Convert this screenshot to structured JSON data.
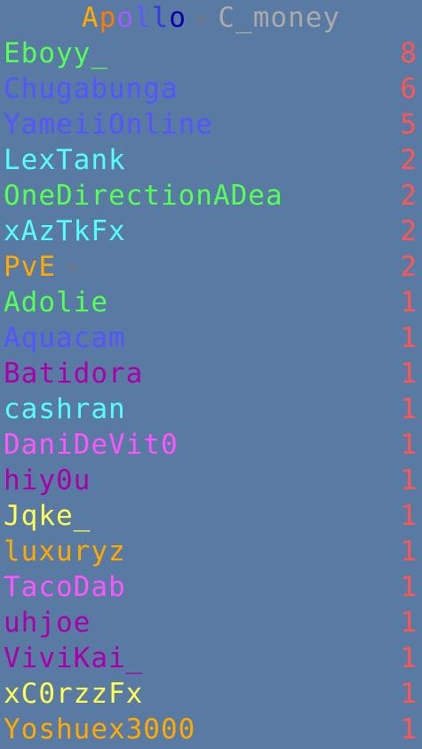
{
  "header": {
    "brand_letters": [
      {
        "ch": "A",
        "color": "#FFAA00"
      },
      {
        "ch": "p",
        "color": "#FF7A00"
      },
      {
        "ch": "o",
        "color": "#A35AFF"
      },
      {
        "ch": "l",
        "color": "#5A5AFF"
      },
      {
        "ch": "l",
        "color": "#3A3AE0"
      },
      {
        "ch": "o",
        "color": "#0000AA"
      }
    ],
    "separator": "»",
    "server_name": "C_money"
  },
  "scoreboard": [
    {
      "name": "Eboyy_",
      "score": "8",
      "color": "#55FF55"
    },
    {
      "name": "Chugabunga",
      "score": "6",
      "color": "#5555FF"
    },
    {
      "name": "YameiiOnline",
      "score": "5",
      "color": "#5555FF"
    },
    {
      "name": "LexTank",
      "score": "2",
      "color": "#55FFFF"
    },
    {
      "name": "OneDirectionADea",
      "score": "2",
      "color": "#55FF55"
    },
    {
      "name": "xAzTkFx",
      "score": "2",
      "color": "#55FFFF"
    },
    {
      "name": "PvE",
      "score": "2",
      "color": "#FFAA00",
      "suffix": "»"
    },
    {
      "name": "Adolie",
      "score": "1",
      "color": "#55FF55"
    },
    {
      "name": "Aquacam",
      "score": "1",
      "color": "#5555FF"
    },
    {
      "name": "Batidora",
      "score": "1",
      "color": "#AA00AA"
    },
    {
      "name": "cashran",
      "score": "1",
      "color": "#55FFFF"
    },
    {
      "name": "DaniDeVit0",
      "score": "1",
      "color": "#FF55FF"
    },
    {
      "name": "hiy0u",
      "score": "1",
      "color": "#AA00AA"
    },
    {
      "name": "Jqke_",
      "score": "1",
      "color": "#FFFF55"
    },
    {
      "name": "luxuryz",
      "score": "1",
      "color": "#FFAA00"
    },
    {
      "name": "TacoDab",
      "score": "1",
      "color": "#FF55FF"
    },
    {
      "name": "uhjoe",
      "score": "1",
      "color": "#AA00AA"
    },
    {
      "name": "ViviKai_",
      "score": "1",
      "color": "#AA00AA"
    },
    {
      "name": "xC0rzzFx",
      "score": "1",
      "color": "#FFFF55"
    },
    {
      "name": "Yoshuex3000",
      "score": "1",
      "color": "#FFAA00"
    }
  ],
  "score_color": "#FF5555"
}
